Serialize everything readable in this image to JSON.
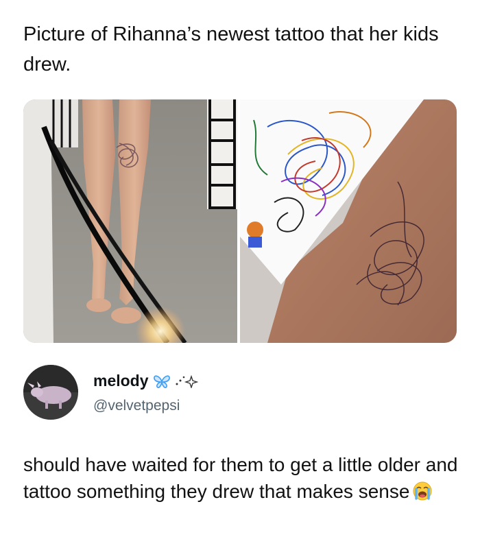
{
  "caption": "Picture of Rihanna’s newest tattoo that her kids drew.",
  "media": {
    "left_photo": "legs-with-scribble-tattoo-photo",
    "right_photo": "drawing-and-tattoo-closeup-photo"
  },
  "author": {
    "display_name": "melody",
    "decoration_icons": [
      "butterfly-icon",
      "sparkle-icon"
    ],
    "handle": "@velvetpepsi",
    "avatar": "animal-avatar"
  },
  "post": {
    "text": "should have waited for them to get a little older and tattoo something they drew that makes sense",
    "emoji": "loudly-crying-face-icon"
  },
  "colors": {
    "text": "#111111",
    "handle": "#536471",
    "butterfly": "#3b9cf4"
  }
}
